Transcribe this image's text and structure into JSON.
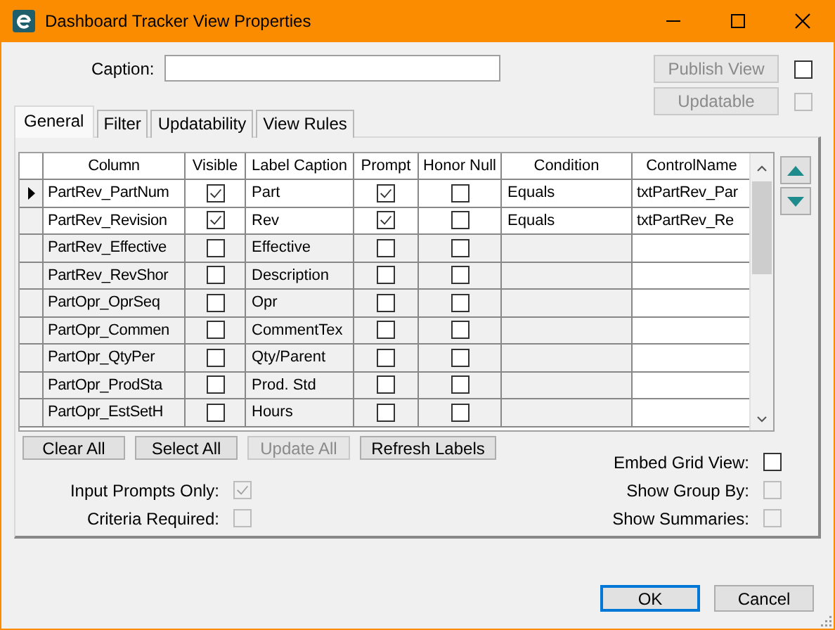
{
  "window": {
    "title": "Dashboard Tracker View Properties"
  },
  "caption": {
    "label": "Caption:"
  },
  "publish_view": {
    "label": "Publish View",
    "disabled": true,
    "checked": false,
    "checkbox_disabled": false
  },
  "updatable": {
    "label": "Updatable",
    "disabled": true,
    "checked": false,
    "checkbox_disabled": true
  },
  "tabs": [
    {
      "label": "General",
      "selected": true
    },
    {
      "label": "Filter",
      "selected": false
    },
    {
      "label": "Updatability",
      "selected": false
    },
    {
      "label": "View Rules",
      "selected": false
    }
  ],
  "grid": {
    "columns": [
      "Column",
      "Visible",
      "Label Caption",
      "Prompt",
      "Honor Null",
      "Condition",
      "ControlName"
    ],
    "rows": [
      {
        "current": true,
        "column": "PartRev_PartNum",
        "visible": true,
        "label_caption": "Part",
        "prompt": true,
        "honor_null": false,
        "condition": "Equals",
        "control_name": "txtPartRev_Par"
      },
      {
        "current": false,
        "column": "PartRev_Revision",
        "visible": true,
        "label_caption": "Rev",
        "prompt": true,
        "honor_null": false,
        "condition": "Equals",
        "control_name": "txtPartRev_Re"
      },
      {
        "current": false,
        "column": "PartRev_Effective",
        "visible": false,
        "label_caption": "Effective",
        "prompt": false,
        "honor_null": false
      },
      {
        "current": false,
        "column": "PartRev_RevShor",
        "visible": false,
        "label_caption": "Description",
        "prompt": false,
        "honor_null": false
      },
      {
        "current": false,
        "column": "PartOpr_OprSeq",
        "visible": false,
        "label_caption": "Opr",
        "prompt": false,
        "honor_null": false
      },
      {
        "current": false,
        "column": "PartOpr_Commen",
        "visible": false,
        "label_caption": "CommentTex",
        "prompt": false,
        "honor_null": false
      },
      {
        "current": false,
        "column": "PartOpr_QtyPer",
        "visible": false,
        "label_caption": "Qty/Parent",
        "prompt": false,
        "honor_null": false
      },
      {
        "current": false,
        "column": "PartOpr_ProdSta",
        "visible": false,
        "label_caption": "Prod. Std",
        "prompt": false,
        "honor_null": false
      },
      {
        "current": false,
        "column": "PartOpr_EstSetH",
        "visible": false,
        "label_caption": "Hours",
        "prompt": false,
        "honor_null": false
      }
    ]
  },
  "grid_buttons": [
    {
      "label": "Clear All",
      "disabled": false
    },
    {
      "label": "Select All",
      "disabled": false
    },
    {
      "label": "Update All",
      "disabled": true
    },
    {
      "label": "Refresh Labels",
      "disabled": false
    }
  ],
  "left_options": [
    {
      "label": "Input Prompts Only:",
      "checked": true,
      "disabled": true
    },
    {
      "label": "Criteria Required:",
      "checked": false,
      "disabled": true
    }
  ],
  "right_options": [
    {
      "label": "Embed Grid View:",
      "checked": false,
      "disabled": false
    },
    {
      "label": "Show Group By:",
      "checked": false,
      "disabled": true
    },
    {
      "label": "Show Summaries:",
      "checked": false,
      "disabled": true
    }
  ],
  "dialog_buttons": [
    {
      "label": "OK",
      "default": true
    },
    {
      "label": "Cancel",
      "default": false
    }
  ]
}
